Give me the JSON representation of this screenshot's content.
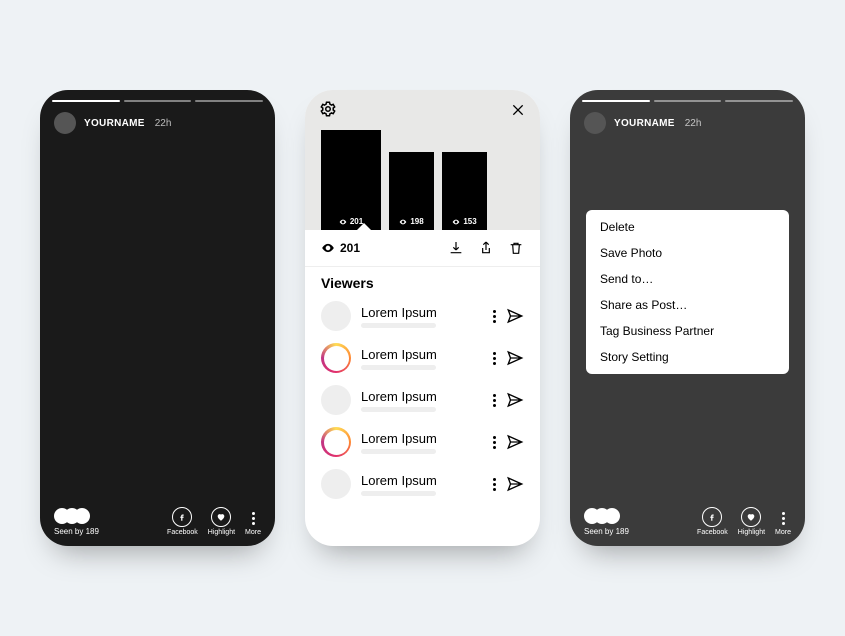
{
  "user": {
    "name": "YOURNAME",
    "time": "22h"
  },
  "seen_label": "Seen by 189",
  "actions": {
    "facebook": "Facebook",
    "highlight": "Highlight",
    "more": "More"
  },
  "viewers_panel": {
    "total_count": "201",
    "tiles": [
      {
        "count": "201"
      },
      {
        "count": "198"
      },
      {
        "count": "153"
      }
    ],
    "section_title": "Viewers",
    "list": [
      {
        "name": "Lorem Ipsum",
        "ring": "gray"
      },
      {
        "name": "Lorem Ipsum",
        "ring": "grad"
      },
      {
        "name": "Lorem Ipsum",
        "ring": "gray"
      },
      {
        "name": "Lorem Ipsum",
        "ring": "grad"
      },
      {
        "name": "Lorem Ipsum",
        "ring": "gray"
      }
    ]
  },
  "menu": {
    "items": [
      "Delete",
      "Save Photo",
      "Send to…",
      "Share as Post…",
      "Tag Business Partner",
      "Story Setting"
    ]
  }
}
